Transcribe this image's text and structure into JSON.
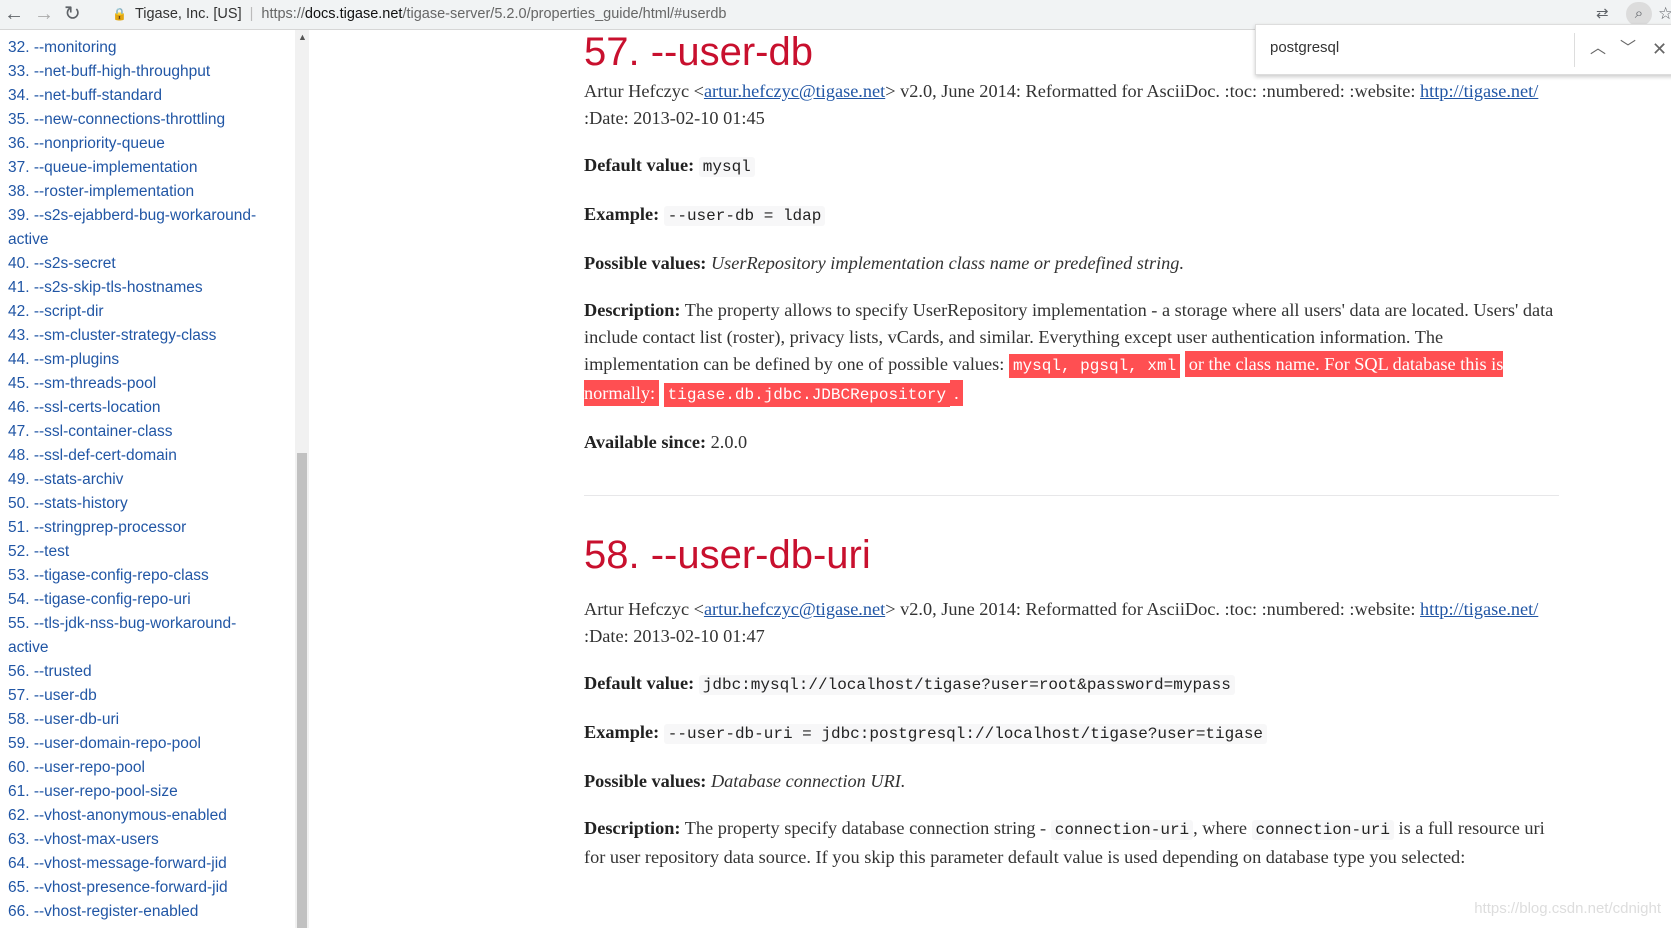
{
  "browser": {
    "site_info": "Tigase, Inc. [US]",
    "url_scheme": "https://",
    "url_host": "docs.tigase.net",
    "url_path": "/tigase-server/5.2.0/properties_guide/html/#userdb"
  },
  "find": {
    "query": "postgresql"
  },
  "sidebar": {
    "items": [
      "32. --monitoring",
      "33. --net-buff-high-throughput",
      "34. --net-buff-standard",
      "35. --new-connections-throttling",
      "36. --nonpriority-queue",
      "37. --queue-implementation",
      "38. --roster-implementation",
      "39. --s2s-ejabberd-bug-workaround-active",
      "40. --s2s-secret",
      "41. --s2s-skip-tls-hostnames",
      "42. --script-dir",
      "43. --sm-cluster-strategy-class",
      "44. --sm-plugins",
      "45. --sm-threads-pool",
      "46. --ssl-certs-location",
      "47. --ssl-container-class",
      "48. --ssl-def-cert-domain",
      "49. --stats-archiv",
      "50. --stats-history",
      "51. --stringprep-processor",
      "52. --test",
      "53. --tigase-config-repo-class",
      "54. --tigase-config-repo-uri",
      "55. --tls-jdk-nss-bug-workaround-active",
      "56. --trusted",
      "57. --user-db",
      "58. --user-db-uri",
      "59. --user-domain-repo-pool",
      "60. --user-repo-pool",
      "61. --user-repo-pool-size",
      "62. --vhost-anonymous-enabled",
      "63. --vhost-max-users",
      "64. --vhost-message-forward-jid",
      "65. --vhost-presence-forward-jid",
      "66. --vhost-register-enabled"
    ]
  },
  "s57": {
    "title": "57. --user-db",
    "author_pre": "Artur Hefczyc <",
    "email": "artur.hefczyc@tigase.net",
    "author_post": "> v2.0, June 2014: Reformatted for AsciiDoc. :toc: :numbered: :website: ",
    "website": "http://tigase.net/",
    "date": " :Date: 2013-02-10 01:45",
    "default_label": "Default value:",
    "default_value": "mysql",
    "example_label": "Example:",
    "example_value": "--user-db = ldap",
    "possible_label": "Possible values:",
    "possible_value": "UserRepository implementation class name or predefined string.",
    "desc_label": "Description:",
    "desc_text": "The property allows to specify UserRepository implementation - a storage where all users' data are located. Users' data include contact list (roster), privacy lists, vCards, and similar. Everything except user authentication information. The implementation can be defined by one of possible values: ",
    "desc_code1": "mysql, pgsql, xml",
    "desc_mid": "or the class name. For SQL database this is normally:",
    "desc_code2": "tigase.db.jdbc.JDBCRepository",
    "desc_end": ".",
    "since_label": "Available since:",
    "since_value": "2.0.0"
  },
  "s58": {
    "title": "58. --user-db-uri",
    "author_pre": "Artur Hefczyc <",
    "email": "artur.hefczyc@tigase.net",
    "author_post": "> v2.0, June 2014: Reformatted for AsciiDoc. :toc: :numbered: :website: ",
    "website": "http://tigase.net/",
    "date": " :Date: 2013-02-10 01:47",
    "default_label": "Default value:",
    "default_value": "jdbc:mysql://localhost/tigase?user=root&password=mypass",
    "example_label": "Example:",
    "example_value": "--user-db-uri = jdbc:postgresql://localhost/tigase?user=tigase",
    "possible_label": "Possible values:",
    "possible_value": "Database connection URI.",
    "desc_label": "Description:",
    "desc_pre": "The property specify database connection string - ",
    "desc_code1": "connection-uri",
    "desc_mid": ", where ",
    "desc_code2": "connection-uri",
    "desc_post": " is a full resource uri for user repository data source. If you skip this parameter default value is used depending on database type you selected:"
  },
  "watermark": "https://blog.csdn.net/cdnight",
  "colors": {
    "heading": "#c8102e",
    "link": "#2156a5",
    "find_highlight": "#ff4f52"
  }
}
